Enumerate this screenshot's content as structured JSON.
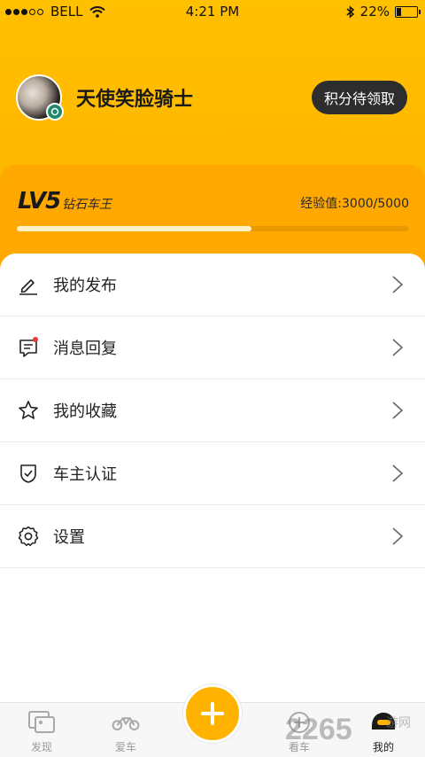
{
  "status_bar": {
    "carrier": "BELL",
    "time": "4:21 PM",
    "battery": "22%",
    "battery_level": 0.22
  },
  "profile": {
    "username": "天使笑脸骑士",
    "points_button": "积分待领取"
  },
  "level": {
    "badge": "LV5",
    "title": "钻石车王",
    "experience": "经验值:3000/5000",
    "progress": 0.6
  },
  "menu": {
    "items": [
      {
        "label": "我的发布",
        "icon": "pencil-icon"
      },
      {
        "label": "消息回复",
        "icon": "message-icon",
        "has_dot": true
      },
      {
        "label": "我的收藏",
        "icon": "star-icon"
      },
      {
        "label": "车主认证",
        "icon": "shield-check-icon"
      },
      {
        "label": "设置",
        "icon": "gear-icon"
      }
    ]
  },
  "bottom_nav": {
    "items": [
      {
        "label": "发现",
        "icon": "discover-icon",
        "active": false
      },
      {
        "label": "爱车",
        "icon": "motorcycle-icon",
        "active": false
      },
      {
        "label": "看车",
        "icon": "view-car-icon",
        "active": false
      },
      {
        "label": "我的",
        "icon": "helmet-icon",
        "active": true
      }
    ],
    "fab_icon": "plus-icon"
  },
  "watermark": {
    "brand": "2265",
    "text": "游网"
  },
  "colors": {
    "header_yellow": "#ffc000",
    "level_orange": "#ffa800",
    "dark_button": "#2d2d2d",
    "notification_red": "#e53935",
    "fab": "#ffb300"
  }
}
